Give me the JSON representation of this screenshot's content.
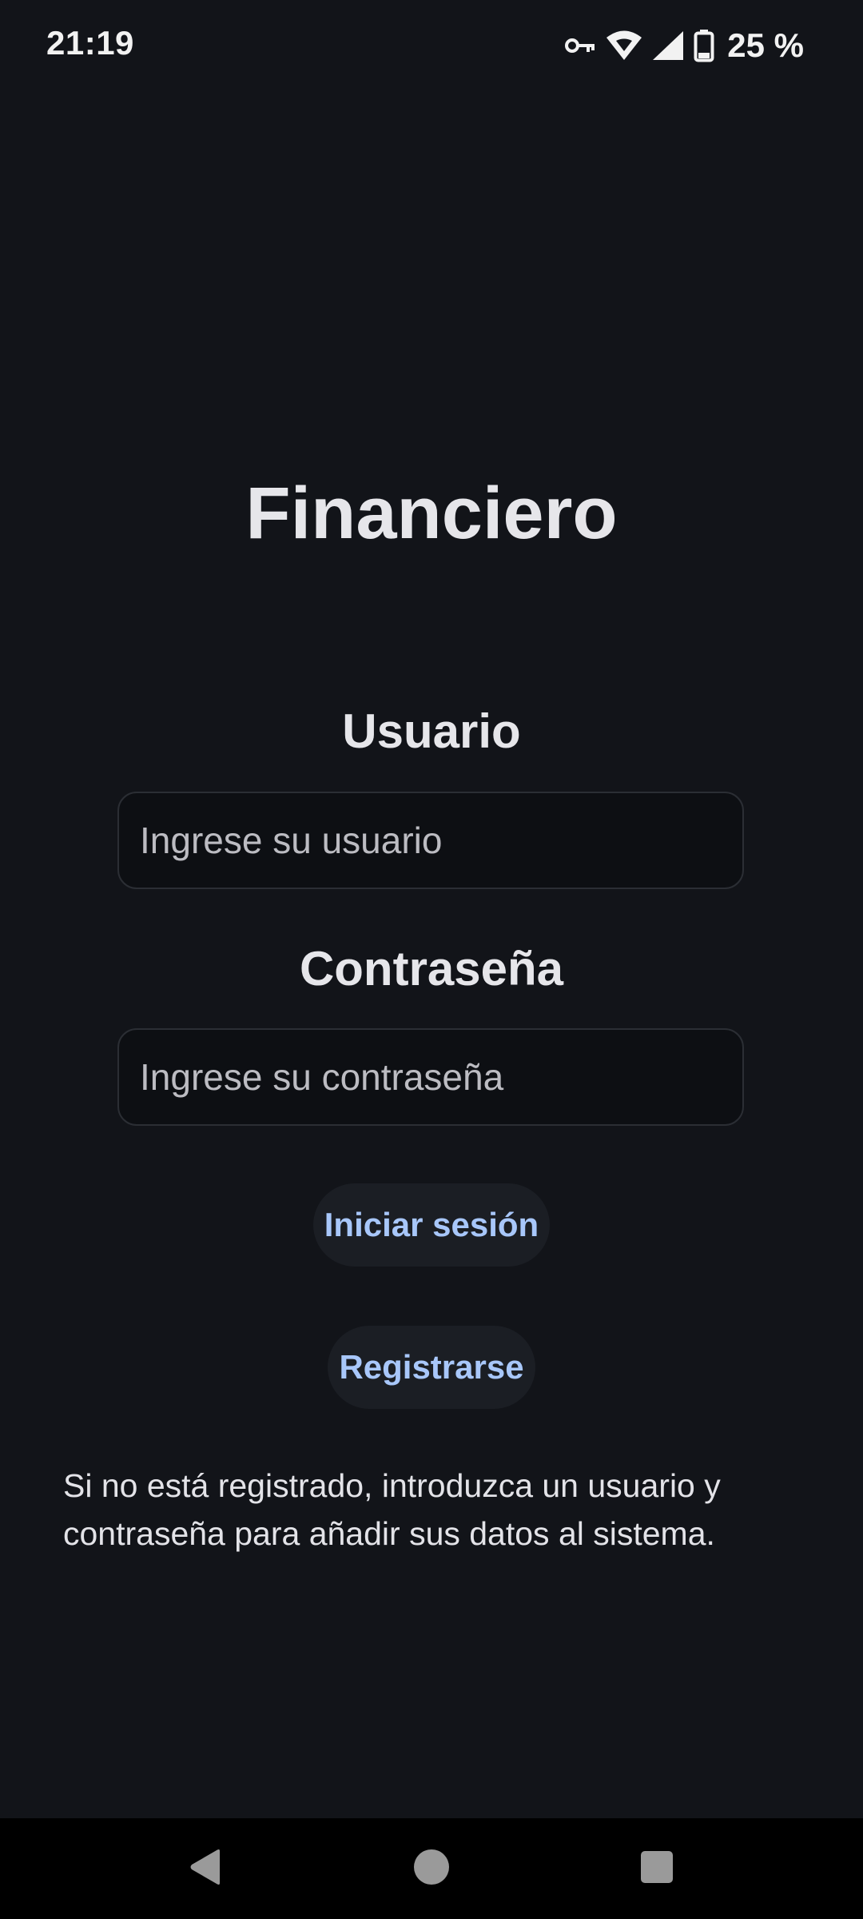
{
  "status_bar": {
    "time": "21:19",
    "battery_text": "25 %",
    "icons": [
      "vpn-key-icon",
      "wifi-icon",
      "cell-signal-icon",
      "battery-icon"
    ]
  },
  "app": {
    "title": "Financiero"
  },
  "login_form": {
    "username_label": "Usuario",
    "username_placeholder": "Ingrese su usuario",
    "username_value": "",
    "password_label": "Contraseña",
    "password_placeholder": "Ingrese su contraseña",
    "password_value": "",
    "login_button_label": "Iniciar sesión",
    "register_button_label": "Registrarse",
    "help_text": "Si no está registrado, introduzca un usuario y contraseña para añadir sus datos al sistema."
  },
  "nav_bar": {
    "icons": [
      "back-icon",
      "home-icon",
      "recents-icon"
    ]
  },
  "colors": {
    "background": "#121419",
    "text": "#e3e3e8",
    "accent": "#a8c7fa",
    "button_bg": "#1b1e24",
    "field_bg": "#0d0f13"
  }
}
